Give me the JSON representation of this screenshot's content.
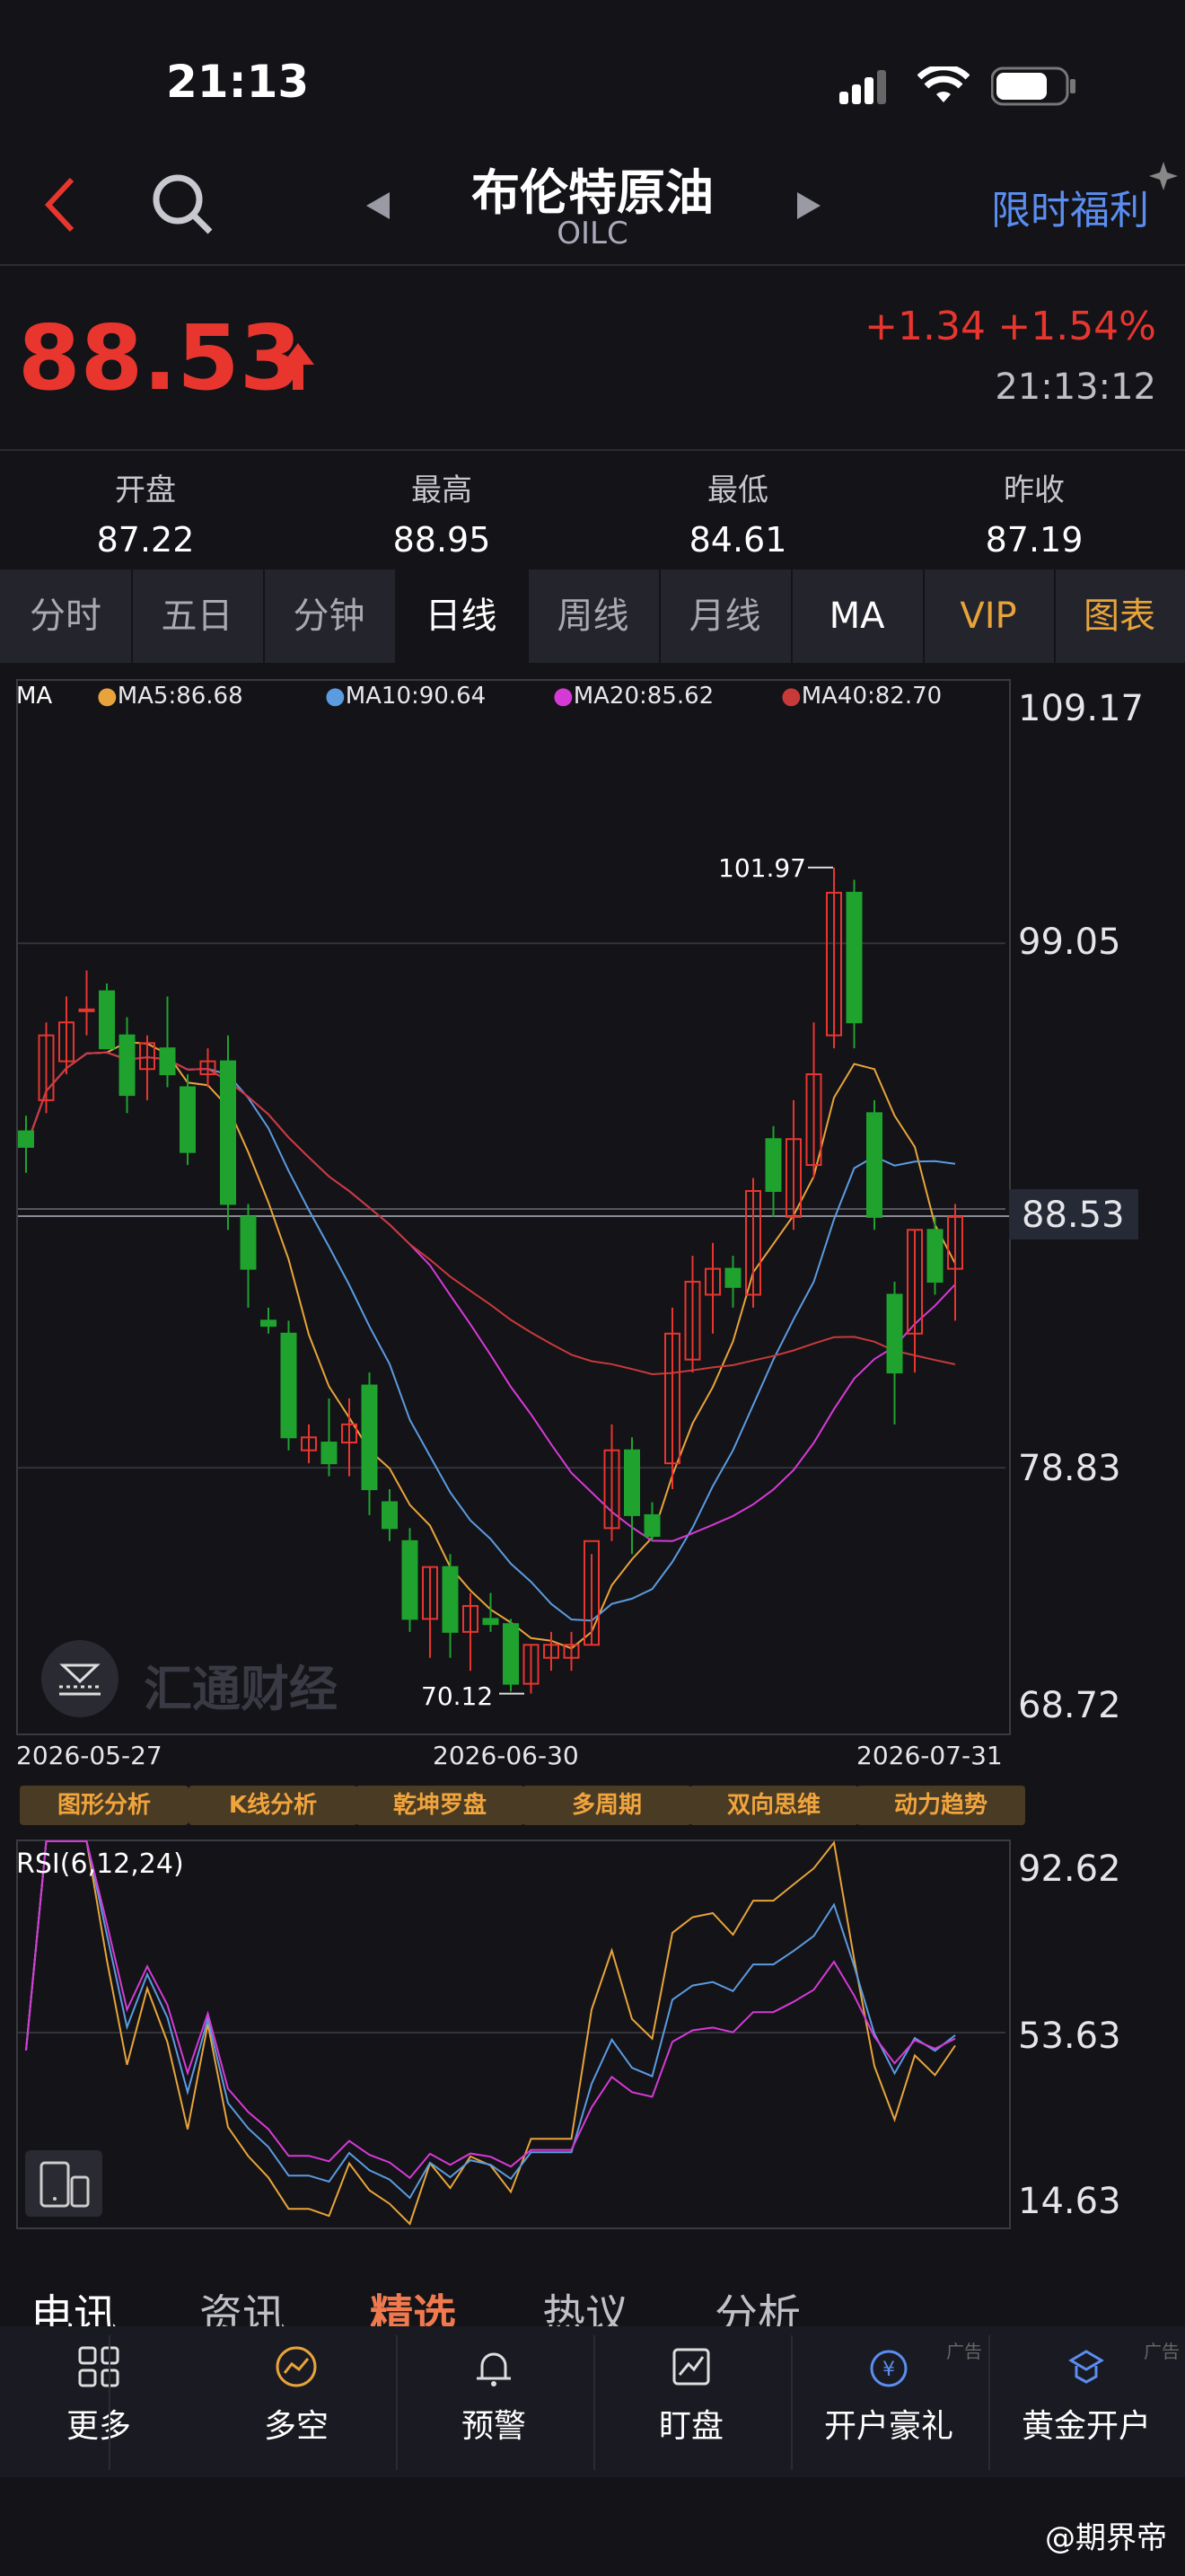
{
  "status": {
    "time": "21:13"
  },
  "header": {
    "title": "布伦特原油",
    "subtitle": "OILC",
    "promo": "限时福利"
  },
  "quote": {
    "price": "88.53",
    "change": "+1.34",
    "percent": "+1.54%",
    "time": "21:13:12"
  },
  "stats": [
    {
      "label": "开盘",
      "value": "87.22"
    },
    {
      "label": "最高",
      "value": "88.95"
    },
    {
      "label": "最低",
      "value": "84.61"
    },
    {
      "label": "昨收",
      "value": "87.19"
    }
  ],
  "tabs": [
    "分时",
    "五日",
    "分钟",
    "日线",
    "周线",
    "月线",
    "MA",
    "VIP",
    "图表"
  ],
  "colors": {
    "up": "#e8362f",
    "down": "#1fa32e",
    "ma5": "#e8a43a",
    "ma10": "#5b9be0",
    "ma20": "#d63ad6",
    "ma40": "#c83a3a",
    "accent": "#5b8ef0"
  },
  "chart_data": {
    "type": "candlestick",
    "ma_label": "MA",
    "ma_legend": [
      {
        "label": "MA5:86.68",
        "color": "#e8a43a"
      },
      {
        "label": "MA10:90.64",
        "color": "#5b9be0"
      },
      {
        "label": "MA20:85.62",
        "color": "#d63ad6"
      },
      {
        "label": "MA40:82.70",
        "color": "#c83a3a"
      }
    ],
    "ylim": [
      68.72,
      109.17
    ],
    "y_ticks": [
      "109.17",
      "99.05",
      "88.53",
      "78.83",
      "68.72"
    ],
    "current_price": 88.53,
    "high_annotation": "101.97",
    "low_annotation": "70.12",
    "x_ticks": [
      "2026-05-27",
      "2026-06-30",
      "2026-07-31"
    ],
    "candles": [
      [
        91.8,
        92.4,
        90.2,
        91.2
      ],
      [
        93.0,
        96.0,
        92.5,
        95.5
      ],
      [
        94.5,
        97.0,
        94.0,
        96.0
      ],
      [
        96.5,
        98.0,
        95.5,
        96.5
      ],
      [
        97.2,
        97.5,
        95.0,
        95.0
      ],
      [
        95.5,
        96.2,
        92.5,
        93.2
      ],
      [
        94.2,
        95.5,
        93.0,
        95.2
      ],
      [
        95.0,
        97.0,
        93.5,
        94.0
      ],
      [
        93.5,
        94.0,
        90.5,
        91.0
      ],
      [
        94.0,
        95.0,
        93.5,
        94.5
      ],
      [
        94.5,
        95.5,
        88.0,
        89.0
      ],
      [
        88.5,
        89.0,
        85.0,
        86.5
      ],
      [
        84.5,
        85.0,
        84.0,
        84.3
      ],
      [
        84.0,
        84.5,
        79.5,
        80.0
      ],
      [
        79.5,
        80.5,
        79.0,
        80.0
      ],
      [
        79.8,
        81.5,
        78.5,
        79.0
      ],
      [
        79.8,
        81.5,
        78.5,
        80.5
      ],
      [
        82.0,
        82.5,
        77.0,
        78.0
      ],
      [
        77.5,
        78.0,
        76.0,
        76.5
      ],
      [
        76.0,
        76.5,
        72.5,
        73.0
      ],
      [
        73.0,
        75.0,
        71.5,
        75.0
      ],
      [
        75.0,
        75.5,
        71.5,
        72.5
      ],
      [
        72.5,
        74.0,
        71.0,
        73.5
      ],
      [
        73.0,
        74.0,
        72.5,
        72.8
      ],
      [
        72.8,
        73.0,
        70.2,
        70.5
      ],
      [
        70.5,
        72.0,
        70.12,
        72.0
      ],
      [
        71.5,
        72.5,
        71.0,
        72.0
      ],
      [
        71.5,
        72.5,
        71.0,
        72.0
      ],
      [
        72.0,
        75.5,
        72.0,
        76.0
      ],
      [
        76.5,
        80.5,
        76.0,
        79.5
      ],
      [
        79.5,
        80.0,
        75.5,
        77.0
      ],
      [
        77.0,
        77.5,
        76.0,
        76.2
      ],
      [
        79.0,
        85.0,
        78.0,
        84.0
      ],
      [
        83.0,
        87.0,
        82.5,
        86.0
      ],
      [
        85.5,
        87.5,
        84.0,
        86.5
      ],
      [
        86.5,
        87.0,
        85.0,
        85.8
      ],
      [
        85.5,
        90.0,
        85.0,
        89.5
      ],
      [
        91.5,
        92.0,
        88.5,
        89.5
      ],
      [
        88.5,
        93.0,
        88.0,
        91.5
      ],
      [
        90.5,
        96.0,
        90.0,
        94.0
      ],
      [
        95.5,
        101.97,
        95.0,
        101.0
      ],
      [
        101.0,
        101.5,
        95.0,
        96.0
      ],
      [
        92.5,
        93.0,
        88.0,
        88.5
      ],
      [
        85.5,
        86.0,
        80.5,
        82.5
      ],
      [
        84.0,
        88.0,
        82.5,
        88.0
      ],
      [
        88.0,
        88.5,
        85.5,
        86.0
      ],
      [
        86.5,
        89.0,
        84.5,
        88.5
      ]
    ],
    "rsi": {
      "label": "RSI(6,12,24)",
      "ylim": [
        14.63,
        92.62
      ],
      "y_ticks": [
        "92.62",
        "53.63",
        "14.63"
      ]
    }
  },
  "tools": [
    "图形分析",
    "K线分析",
    "乾坤罗盘",
    "多周期",
    "双向思维",
    "动力趋势"
  ],
  "bottom_tabs": [
    "电讯",
    "资讯",
    "精选",
    "热议",
    "分析"
  ],
  "toolbar": [
    {
      "label": "更多",
      "icon": "grid-icon"
    },
    {
      "label": "多空",
      "icon": "gauge-icon"
    },
    {
      "label": "预警",
      "icon": "bell-icon"
    },
    {
      "label": "盯盘",
      "icon": "chart-watch-icon"
    },
    {
      "label": "开户豪礼",
      "icon": "gift-icon",
      "ad": "广告"
    },
    {
      "label": "黄金开户",
      "icon": "gold-icon",
      "ad": "广告"
    }
  ],
  "watermark": "汇通财经",
  "footer": "@期界帝"
}
